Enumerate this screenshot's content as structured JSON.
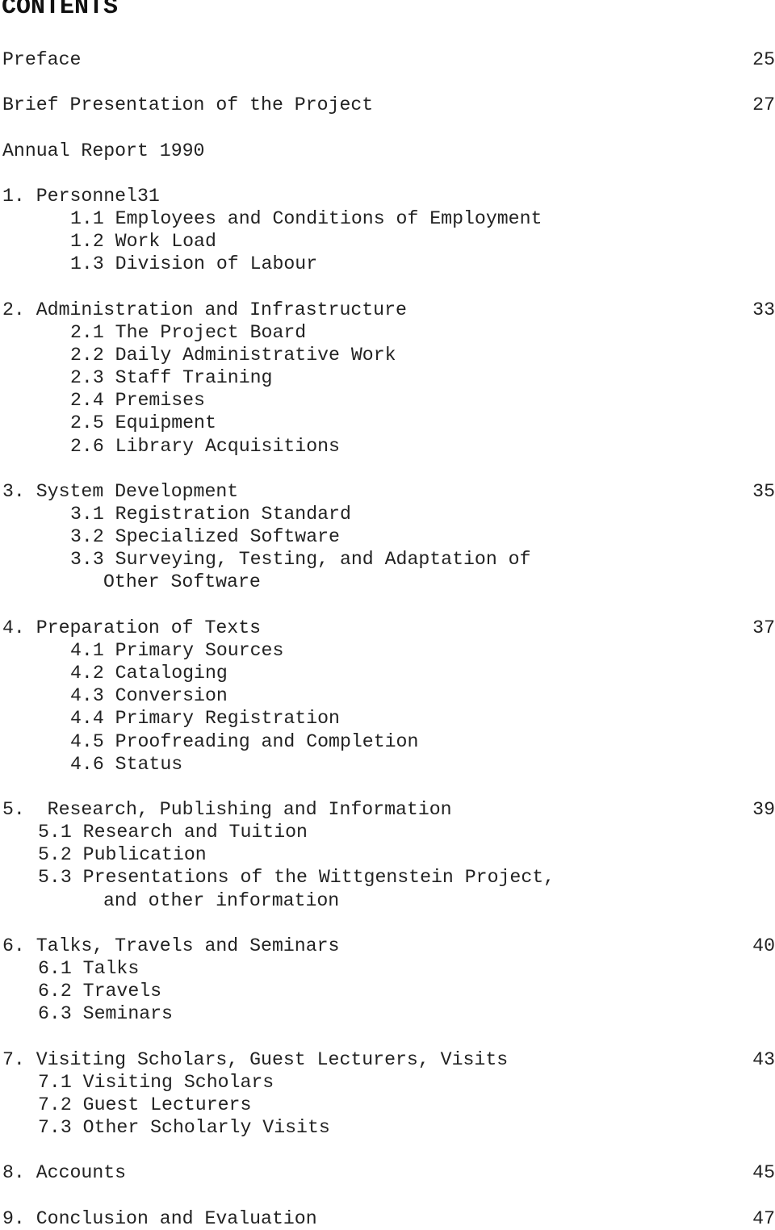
{
  "title": "CONTENTS",
  "entries": [
    {
      "text": "Preface",
      "page": "25",
      "indent": 0,
      "row": 0
    },
    {
      "text": "Brief Presentation of the Project",
      "page": "27",
      "indent": 0,
      "row": 2
    },
    {
      "text": "Annual Report 1990",
      "page": "",
      "indent": 0,
      "row": 4
    },
    {
      "text": "1. Personnel31",
      "page": "",
      "indent": 0,
      "row": 6
    },
    {
      "text": "1.1 Employees and Conditions of Employment",
      "page": "",
      "indent": 2,
      "row": 7
    },
    {
      "text": "1.2 Work Load",
      "page": "",
      "indent": 2,
      "row": 8
    },
    {
      "text": "1.3 Division of Labour",
      "page": "",
      "indent": 2,
      "row": 9
    },
    {
      "text": "2. Administration and Infrastructure",
      "page": "33",
      "indent": 0,
      "row": 11
    },
    {
      "text": "2.1 The Project Board",
      "page": "",
      "indent": 2,
      "row": 12
    },
    {
      "text": "2.2 Daily Administrative Work",
      "page": "",
      "indent": 2,
      "row": 13
    },
    {
      "text": "2.3 Staff Training",
      "page": "",
      "indent": 2,
      "row": 14
    },
    {
      "text": "2.4 Premises",
      "page": "",
      "indent": 2,
      "row": 15
    },
    {
      "text": "2.5 Equipment",
      "page": "",
      "indent": 2,
      "row": 16
    },
    {
      "text": "2.6 Library Acquisitions",
      "page": "",
      "indent": 2,
      "row": 17
    },
    {
      "text": "3. System Development",
      "page": "35",
      "indent": 0,
      "row": 19
    },
    {
      "text": "3.1 Registration Standard",
      "page": "",
      "indent": 2,
      "row": 20
    },
    {
      "text": "3.2 Specialized Software",
      "page": "",
      "indent": 2,
      "row": 21
    },
    {
      "text": "3.3 Surveying, Testing, and Adaptation of",
      "page": "",
      "indent": 2,
      "row": 22
    },
    {
      "text": "Other Software",
      "page": "",
      "indent": 3,
      "row": 23
    },
    {
      "text": "4. Preparation of Texts",
      "page": "37",
      "indent": 0,
      "row": 25
    },
    {
      "text": "4.1 Primary Sources",
      "page": "",
      "indent": 2,
      "row": 26
    },
    {
      "text": "4.2 Cataloging",
      "page": "",
      "indent": 2,
      "row": 27
    },
    {
      "text": "4.3 Conversion",
      "page": "",
      "indent": 2,
      "row": 28
    },
    {
      "text": "4.4 Primary Registration",
      "page": "",
      "indent": 2,
      "row": 29
    },
    {
      "text": "4.5 Proofreading and Completion",
      "page": "",
      "indent": 2,
      "row": 30
    },
    {
      "text": "4.6 Status",
      "page": "",
      "indent": 2,
      "row": 31
    },
    {
      "text": "5.  Research, Publishing and Information",
      "page": "39",
      "indent": 0,
      "row": 33
    },
    {
      "text": "5.1 Research and Tuition",
      "page": "",
      "indent": 1,
      "row": 34
    },
    {
      "text": "5.2 Publication",
      "page": "",
      "indent": 1,
      "row": 35
    },
    {
      "text": "5.3 Presentations of the Wittgenstein Project,",
      "page": "",
      "indent": 1,
      "row": 36
    },
    {
      "text": "and other information",
      "page": "",
      "indent": 3,
      "row": 37
    },
    {
      "text": "6. Talks, Travels and Seminars",
      "page": "40",
      "indent": 0,
      "row": 39
    },
    {
      "text": "6.1 Talks",
      "page": "",
      "indent": 1,
      "row": 40
    },
    {
      "text": "6.2 Travels",
      "page": "",
      "indent": 1,
      "row": 41
    },
    {
      "text": "6.3 Seminars",
      "page": "",
      "indent": 1,
      "row": 42
    },
    {
      "text": "7. Visiting Scholars, Guest Lecturers, Visits",
      "page": "43",
      "indent": 0,
      "row": 44
    },
    {
      "text": "7.1 Visiting Scholars",
      "page": "",
      "indent": 1,
      "row": 45
    },
    {
      "text": "7.2 Guest Lecturers",
      "page": "",
      "indent": 1,
      "row": 46
    },
    {
      "text": "7.3 Other Scholarly Visits",
      "page": "",
      "indent": 1,
      "row": 47
    },
    {
      "text": "8. Accounts",
      "page": "45",
      "indent": 0,
      "row": 49
    },
    {
      "text": "9. Conclusion and Evaluation",
      "page": "47",
      "indent": 0,
      "row": 51
    }
  ]
}
